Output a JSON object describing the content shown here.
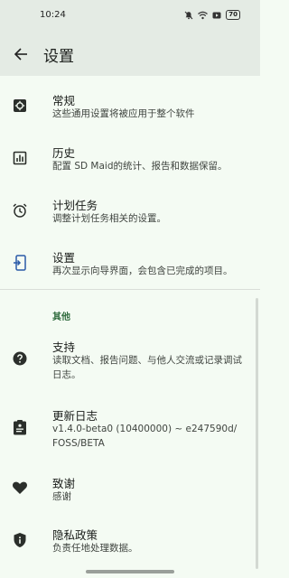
{
  "status": {
    "time": "10:24",
    "battery": "70"
  },
  "header": {
    "title": "设置"
  },
  "main_items": [
    {
      "title": "常规",
      "desc": "这些通用设置将被应用于整个软件",
      "icon": "gear-icon"
    },
    {
      "title": "历史",
      "desc": "配置 SD Maid的统计、报告和数据保留。",
      "icon": "chart-icon"
    },
    {
      "title": "计划任务",
      "desc": "调整计划任务相关的设置。",
      "icon": "alarm-icon"
    },
    {
      "title": "设置",
      "desc": "再次显示向导界面，会包含已完成的项目。",
      "icon": "setup-icon"
    }
  ],
  "section": {
    "other_label": "其他"
  },
  "other_items": [
    {
      "title": "支持",
      "desc": "读取文档、报告问题、与他人交流或记录调试日志。",
      "icon": "help-icon"
    },
    {
      "title": "更新日志",
      "desc": "v1.4.0-beta0 (10400000) ~ e247590d/ FOSS/BETA",
      "icon": "changelog-icon"
    },
    {
      "title": "致谢",
      "desc": "感谢",
      "icon": "heart-icon"
    },
    {
      "title": "隐私政策",
      "desc": "负责任地处理数据。",
      "icon": "shield-icon"
    }
  ]
}
